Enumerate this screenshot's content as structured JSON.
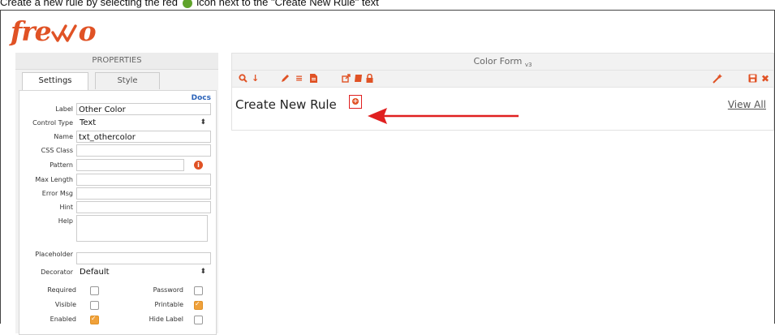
{
  "caption": {
    "prefix": "Create a new rule by selecting the red",
    "suffix": "icon next to the \"Create New Rule\" text"
  },
  "logo": {
    "text": "fre",
    "alt": "frevvo"
  },
  "properties": {
    "header": "PROPERTIES",
    "tabs": [
      "Settings",
      "Style"
    ],
    "docs_link": "Docs",
    "fields": {
      "label": {
        "label": "Label",
        "value": "Other Color"
      },
      "control_type": {
        "label": "Control Type",
        "value": "Text"
      },
      "name": {
        "label": "Name",
        "value": "txt_othercolor"
      },
      "css_class": {
        "label": "CSS Class",
        "value": ""
      },
      "pattern": {
        "label": "Pattern",
        "value": ""
      },
      "max_length": {
        "label": "Max Length",
        "value": ""
      },
      "error_msg": {
        "label": "Error Msg",
        "value": ""
      },
      "hint": {
        "label": "Hint",
        "value": ""
      },
      "help": {
        "label": "Help",
        "value": ""
      },
      "placeholder": {
        "label": "Placeholder",
        "value": ""
      },
      "decorator": {
        "label": "Decorator",
        "value": "Default"
      }
    },
    "checkboxes": {
      "required": {
        "label": "Required",
        "checked": false
      },
      "password": {
        "label": "Password",
        "checked": false
      },
      "visible": {
        "label": "Visible",
        "checked": false
      },
      "printable": {
        "label": "Printable",
        "checked": true
      },
      "enabled": {
        "label": "Enabled",
        "checked": true
      },
      "hide_label": {
        "label": "Hide Label",
        "checked": false
      }
    }
  },
  "form": {
    "title": "Color Form",
    "version": "v3",
    "rule_title": "Create New Rule",
    "view_all": "View All",
    "toolbar_icons": [
      "search-icon",
      "sort-icon",
      "pencil-icon",
      "list-icon",
      "document-icon",
      "external-link-icon",
      "book-icon",
      "lock-icon",
      "magic-wand-icon",
      "save-icon",
      "close-icon"
    ]
  },
  "colors": {
    "brand": "#e05225",
    "highlight": "#e02020",
    "link": "#2a62b8",
    "checkbox_on": "#f0a13a",
    "caption_dot": "#5fa32b"
  }
}
